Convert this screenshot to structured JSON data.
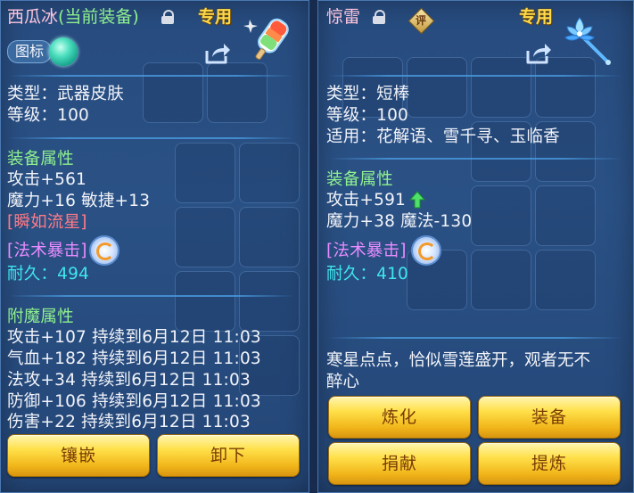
{
  "left_panel": {
    "title_name": "西瓜冰",
    "title_status": "(当前装备)",
    "exclusive_label": "专用",
    "icon_toggle_label": "图标",
    "lines": {
      "type": "类型：武器皮肤",
      "level": "等级：100",
      "attr_header": "装备属性",
      "attack": "攻击+561",
      "magic_agility": "魔力+16 敏捷+13",
      "special": "[瞬如流星]",
      "skill": "[法术暴击]",
      "durability_label": "耐久：",
      "durability_value": "494",
      "enchant_header": "附魔属性",
      "enchant_1": "攻击+107 持续到6月12日 11:03",
      "enchant_2": "气血+182 持续到6月12日 11:03",
      "enchant_3": "法攻+34 持续到6月12日 11:03",
      "enchant_4": "防御+106 持续到6月12日 11:03",
      "enchant_5": "伤害+22 持续到6月12日 11:03"
    },
    "buttons": {
      "inlay": "镶嵌",
      "unequip": "卸下"
    }
  },
  "right_panel": {
    "title_name": "惊雷",
    "rating_badge": "评",
    "exclusive_label": "专用",
    "lines": {
      "type": "类型：短棒",
      "level": "等级：100",
      "applicable": "适用：花解语、雪千寻、玉临香",
      "attr_header": "装备属性",
      "attack": "攻击+591",
      "magic_spell": "魔力+38 魔法-130",
      "skill": "[法术暴击]",
      "durability_label": "耐久：",
      "durability_value": "410"
    },
    "description_line1": "寒星点点，恰似雪莲盛开，观者无不",
    "description_line2": "醉心",
    "buttons": {
      "refine": "炼化",
      "equip": "装备",
      "donate": "捐献",
      "extract": "提炼"
    }
  },
  "colors": {
    "panel_bg": "#2a5185",
    "button_gold": "#ffe04a",
    "attr_header": "#8ff08e",
    "skill_purple": "#e98cff",
    "value_cyan": "#3fe6ef",
    "special_red": "#ff7a86"
  },
  "icons": [
    "lock-icon",
    "share-icon",
    "watermelon-popsicle-item-icon",
    "rating-badge-icon",
    "lotus-wand-item-icon",
    "spell-crit-skill-icon",
    "green-up-arrow-icon",
    "teal-orb-icon"
  ]
}
